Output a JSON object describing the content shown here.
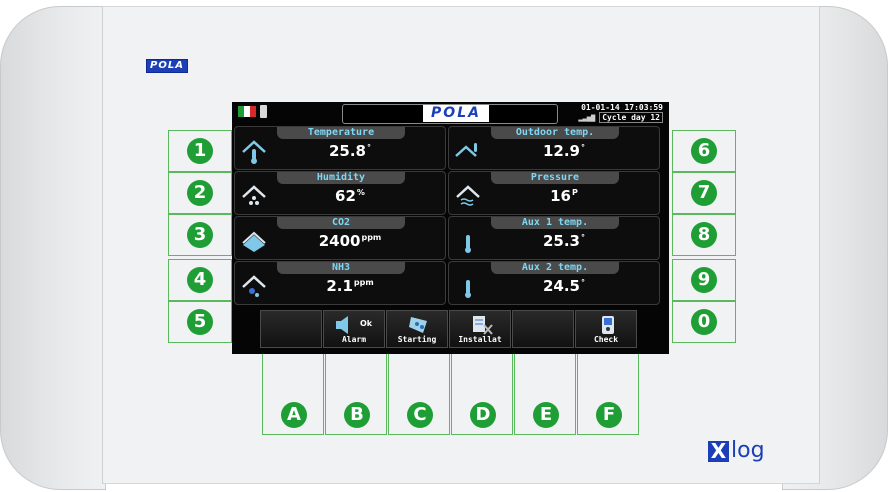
{
  "device": {
    "brand_logo": "POLA",
    "footer_logo_mark": "X",
    "footer_logo_text": "log",
    "accent_color": "#1c3fb8",
    "key_color": "#1f9e35"
  },
  "left_keys": [
    "1",
    "2",
    "3",
    "4",
    "5"
  ],
  "right_keys": [
    "6",
    "7",
    "8",
    "9",
    "0"
  ],
  "bottom_keys": [
    "A",
    "B",
    "C",
    "D",
    "E",
    "F"
  ],
  "screen": {
    "title": "POLA",
    "datetime": "01-01-14  17:03:59",
    "signal": "▂▃▅▇",
    "cycle_day": "Cycle day 12",
    "flag_colors": [
      "#1f9e35",
      "#ffffff",
      "#d62a2a"
    ],
    "tiles": [
      {
        "label": "Temperature",
        "value": "25.8",
        "unit": "°",
        "icon": "thermometer-house-icon"
      },
      {
        "label": "Outdoor temp.",
        "value": "12.9",
        "unit": "°",
        "icon": "outdoor-house-icon"
      },
      {
        "label": "Humidity",
        "value": "62",
        "unit": "%",
        "icon": "humidity-house-icon"
      },
      {
        "label": "Pressure",
        "value": "16",
        "unit": "P",
        "icon": "pressure-house-icon"
      },
      {
        "label": "CO2",
        "value": "2400",
        "unit": "ppm",
        "icon": "co2-house-icon"
      },
      {
        "label": "Aux 1 temp.",
        "value": "25.3",
        "unit": "°",
        "icon": "thermometer-icon"
      },
      {
        "label": "NH3",
        "value": "2.1",
        "unit": "ppm",
        "icon": "nh3-house-icon"
      },
      {
        "label": "Aux 2 temp.",
        "value": "24.5",
        "unit": "°",
        "icon": "thermometer-icon"
      }
    ],
    "softkeys": [
      {
        "label": "",
        "icon": ""
      },
      {
        "label": "Alarm",
        "icon": "speaker-icon",
        "badge": "Ok"
      },
      {
        "label": "Starting",
        "icon": "chicks-icon"
      },
      {
        "label": "Installat",
        "icon": "installation-icon"
      },
      {
        "label": "",
        "icon": ""
      },
      {
        "label": "Check",
        "icon": "check-device-icon"
      }
    ]
  }
}
